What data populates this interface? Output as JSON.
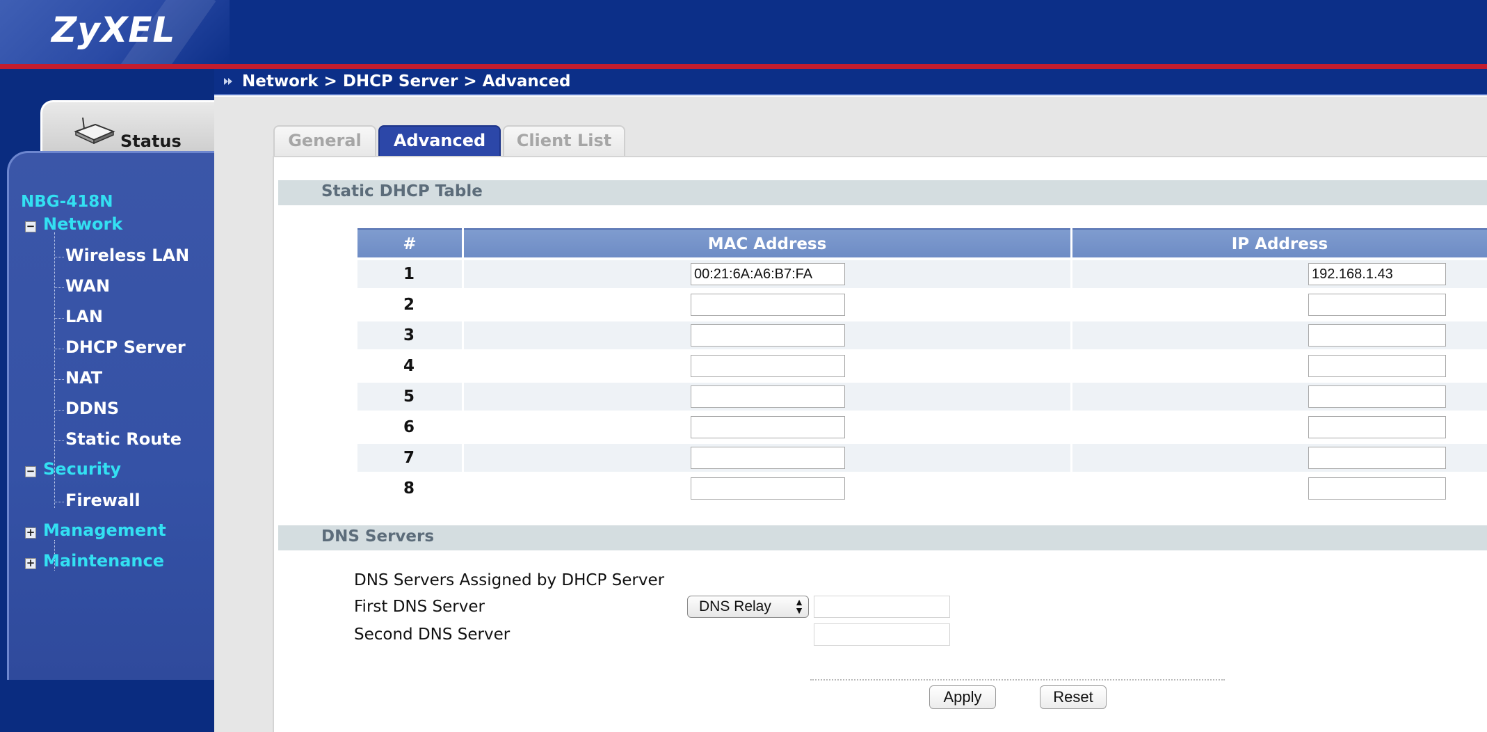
{
  "brand": {
    "logo": "ZyXEL"
  },
  "breadcrumb": "Network > DHCP Server > Advanced",
  "sidebar": {
    "status_label": "Status",
    "device_name": "NBG-418N",
    "network": {
      "label": "Network",
      "items": [
        "Wireless LAN",
        "WAN",
        "LAN",
        "DHCP Server",
        "NAT",
        "DDNS",
        "Static Route"
      ]
    },
    "security": {
      "label": "Security",
      "items": [
        "Firewall"
      ]
    },
    "management": {
      "label": "Management"
    },
    "maintenance": {
      "label": "Maintenance"
    }
  },
  "tabs": [
    {
      "label": "General",
      "active": false
    },
    {
      "label": "Advanced",
      "active": true
    },
    {
      "label": "Client List",
      "active": false
    }
  ],
  "static_dhcp": {
    "title": "Static DHCP Table",
    "headers": {
      "num": "#",
      "mac": "MAC Address",
      "ip": "IP Address"
    },
    "rows": [
      {
        "num": "1",
        "mac": "00:21:6A:A6:B7:FA",
        "ip": "192.168.1.43"
      },
      {
        "num": "2",
        "mac": "",
        "ip": ""
      },
      {
        "num": "3",
        "mac": "",
        "ip": ""
      },
      {
        "num": "4",
        "mac": "",
        "ip": ""
      },
      {
        "num": "5",
        "mac": "",
        "ip": ""
      },
      {
        "num": "6",
        "mac": "",
        "ip": ""
      },
      {
        "num": "7",
        "mac": "",
        "ip": ""
      },
      {
        "num": "8",
        "mac": "",
        "ip": ""
      }
    ]
  },
  "dns": {
    "title": "DNS Servers",
    "assigned_label": "DNS Servers Assigned by DHCP Server",
    "first_label": "First DNS Server",
    "second_label": "Second DNS Server",
    "first_mode": "DNS Relay",
    "first_value": "",
    "second_value": ""
  },
  "buttons": {
    "apply": "Apply",
    "reset": "Reset"
  },
  "colors": {
    "header_blue": "#0c2f88",
    "accent_red": "#c31d2e",
    "nav_cyan": "#33e0f2",
    "tab_active": "#2c47a8"
  }
}
